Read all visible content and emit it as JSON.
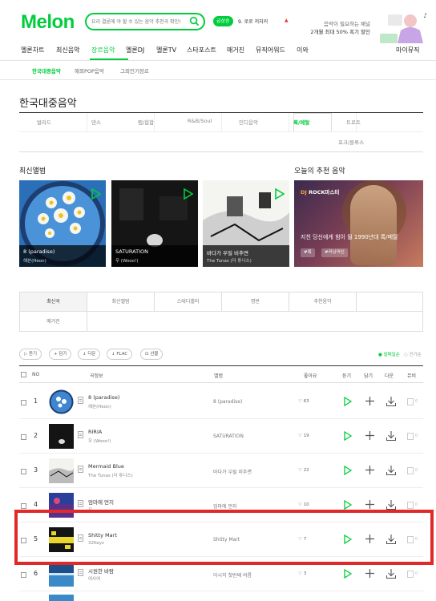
{
  "header": {
    "logo": "Melon",
    "search_placeholder": "요리 결론에 야 할 수 있는 음악 추천곡 확인!",
    "hot_keyword_label": "급상승",
    "hot_keyword_rank": "9. 로로 저지커",
    "hot_keyword_change": "▲",
    "promo_line1": "음악이 필요하는 채널",
    "promo_line2": "2개월 최대 50% 혹기 할인"
  },
  "gnb": [
    "멜론차트",
    "최신음악",
    "장르음악",
    "멜론DJ",
    "멜론TV",
    "스타포스트",
    "매거진",
    "뮤직어워드",
    "이와",
    "마이뮤직"
  ],
  "subnav": [
    "한국대중음악",
    "해외POP음악",
    "그외인기장르"
  ],
  "page_title": "한국대중음악",
  "genres": [
    "발라드",
    "댄스",
    "랩/힙합",
    "R&B/Soul",
    "인디음악",
    "록/메탈",
    "트로트",
    "포크/블루스"
  ],
  "sections": {
    "new_albums": "최신앨범",
    "recommended": "오늘의 추천 음악"
  },
  "albums": [
    {
      "title": "8 (paradise)",
      "artist": "헤븐(Heon)"
    },
    {
      "title": "SATURATION",
      "artist": "우 (Wooo!)"
    },
    {
      "title": "바다가 우릴 비추면",
      "artist": "The Tunas (더 튜나스)"
    }
  ],
  "recommend": {
    "dj_prefix": "DJ",
    "dj_name": "ROCK마스터",
    "desc": "지친 당신에게 힘이 될 1990년대 록/메탈",
    "tags": [
      "#록",
      "#러닝머신"
    ]
  },
  "tabs": [
    "최신곡",
    "최신앨범",
    "스테디셀러",
    "명반",
    "추천음악",
    "매거진"
  ],
  "actions": [
    "듣기",
    "담기",
    "다운",
    "FLAC",
    "선물"
  ],
  "sort": [
    "발매일순",
    "인기순"
  ],
  "table_headers": {
    "no": "NO",
    "song": "곡정보",
    "album": "앨범",
    "likes": "좋아요",
    "listen": "듣기",
    "add": "담기",
    "download": "다운",
    "mv": "뮤비"
  },
  "songs": [
    {
      "rank": "1",
      "title": "8 (paradise)",
      "artist": "헤븐(Heon)",
      "album": "8 (paradise)",
      "likes": "63"
    },
    {
      "rank": "2",
      "title": "RIRIA",
      "artist": "우 (Wooo!)",
      "album": "SATURATION",
      "likes": "19"
    },
    {
      "rank": "3",
      "title": "Mermaid Blue",
      "artist": "The Tunas (더 튜나스)",
      "album": "바다가 우릴 비추면",
      "likes": "22"
    },
    {
      "rank": "4",
      "title": "엄마에 먼지",
      "artist": "우",
      "album": "엄마에 먼지",
      "likes": "10"
    },
    {
      "rank": "5",
      "title": "Shitty Mart",
      "artist": "32Keyz",
      "album": "Shitty Mart",
      "likes": "7"
    },
    {
      "rank": "6",
      "title": "시원한 바람",
      "artist": "여사여",
      "album": "아시히 첫번째 여름",
      "likes": "3"
    }
  ],
  "mv_count": "0",
  "colors": {
    "brand": "#00cd3c",
    "highlight": "#e02a2a"
  }
}
